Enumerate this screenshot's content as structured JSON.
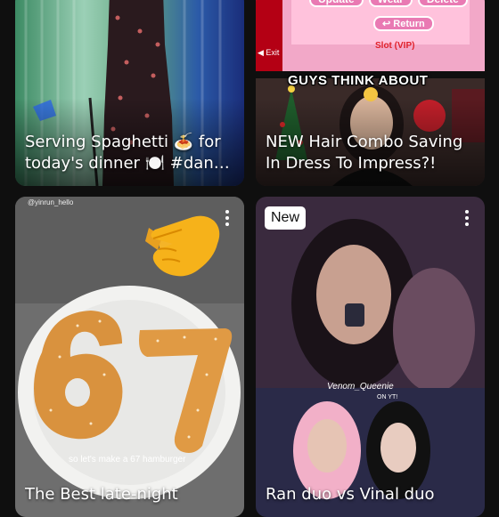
{
  "feed": {
    "cards": [
      {
        "title": "Serving Spaghetti 🍝 for today's dinner 🍽️  #dan…"
      },
      {
        "title": "NEW Hair Combo Saving In Dress To Impress?!",
        "overlay": {
          "banner": "GUYS THINK ABOUT",
          "buttons": [
            "Update",
            "Wear",
            "Delete"
          ],
          "return_label": "Return",
          "exit_label": "Exit",
          "slot_label": "Slot (VIP)"
        }
      },
      {
        "title": "The Best late-night",
        "watermark": "@yinrun_hello",
        "caption": "so let's make a 67 hamburger"
      },
      {
        "title": "Ran duo vs Vinal duo",
        "badge": "New",
        "watermark": "Venom_Queenie",
        "watermark_sub": "ON YT!"
      }
    ]
  },
  "icons": {
    "more": "more-vert-icon",
    "pointing": "pointing-hand-icon"
  }
}
